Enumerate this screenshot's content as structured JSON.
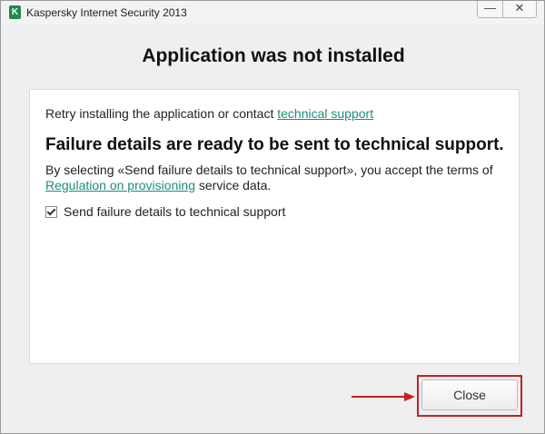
{
  "window": {
    "title": "Kaspersky Internet Security 2013",
    "minimize_glyph": "—",
    "close_glyph": "✕"
  },
  "heading": "Application was not installed",
  "panel": {
    "retry_text": "Retry installing the application or contact ",
    "retry_link": "technical support",
    "subheading": "Failure details are ready to be sent to technical support.",
    "consent_text_before": "By selecting «Send failure details to technical support», you accept the terms of ",
    "consent_link": "Regulation on provisioning",
    "consent_text_after": " service data.",
    "checkbox_label": "Send failure details to technical support",
    "checkbox_checked": true
  },
  "footer": {
    "close_label": "Close"
  },
  "colors": {
    "link": "#1b8f78",
    "highlight": "#c32020",
    "app_icon": "#1e8a4e"
  },
  "icons": {
    "app": "kaspersky-k-icon",
    "minimize": "minimize-icon",
    "close": "close-icon",
    "arrow": "red-arrow-icon"
  }
}
